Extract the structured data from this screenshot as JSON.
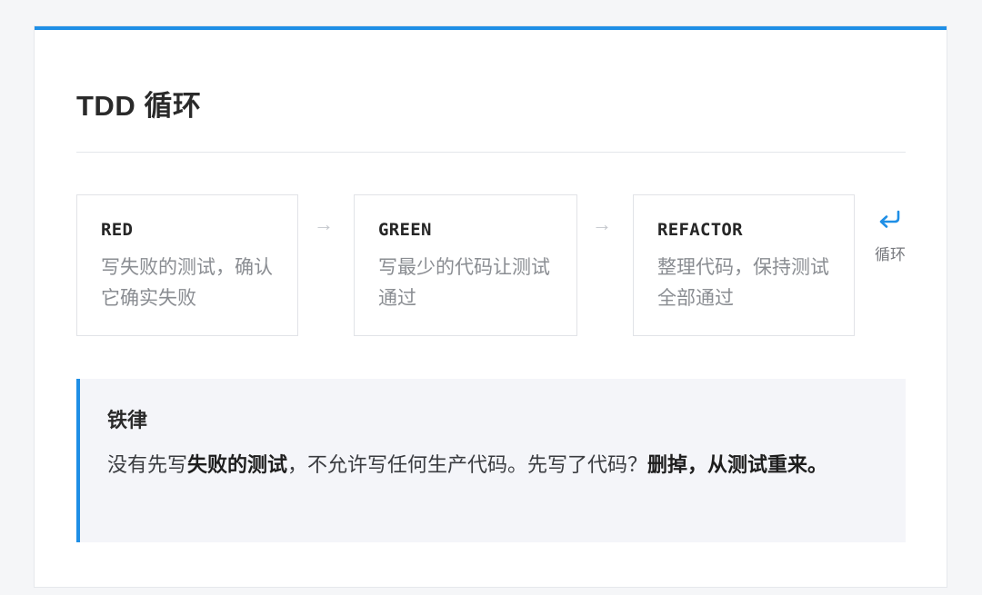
{
  "title": "TDD 循环",
  "steps": [
    {
      "name": "RED",
      "desc": "写失败的测试，确认它确实失败"
    },
    {
      "name": "GREEN",
      "desc": "写最少的代码让测试通过"
    },
    {
      "name": "REFACTOR",
      "desc": "整理代码，保持测试全部通过"
    }
  ],
  "arrow": "→",
  "loop": {
    "icon": "return-arrow-icon",
    "label": "循环"
  },
  "rule": {
    "title": "铁律",
    "text_1": "没有先写",
    "bold_1": "失败的测试",
    "text_2": "，不允许写任何生产代码。先写了代码？",
    "bold_2": "删掉，从测试重来。"
  },
  "colors": {
    "accent": "#1f8fe6",
    "muted_text": "#8a8d92",
    "rule_bg": "#f4f5f9"
  }
}
